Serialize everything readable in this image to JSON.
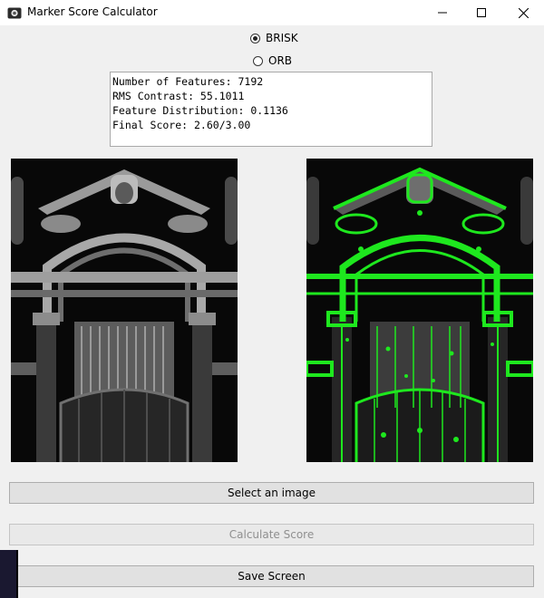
{
  "window": {
    "title": "Marker Score Calculator",
    "icon": "camera-app-icon"
  },
  "options": [
    {
      "label": "BRISK",
      "selected": true
    },
    {
      "label": "ORB",
      "selected": false
    }
  ],
  "results": {
    "lines": [
      "Number of Features: 7192",
      "RMS Contrast: 55.1011",
      "Feature Distribution: 0.1136",
      "Final Score: 2.60/3.00"
    ]
  },
  "images": {
    "original": "grayscale-gate-photo",
    "keypoints": "keypoint-overlay-photo",
    "keypoint_color": "#1ee81e"
  },
  "buttons": {
    "select": "Select an image",
    "calculate": "Calculate Score",
    "save": "Save Screen"
  }
}
